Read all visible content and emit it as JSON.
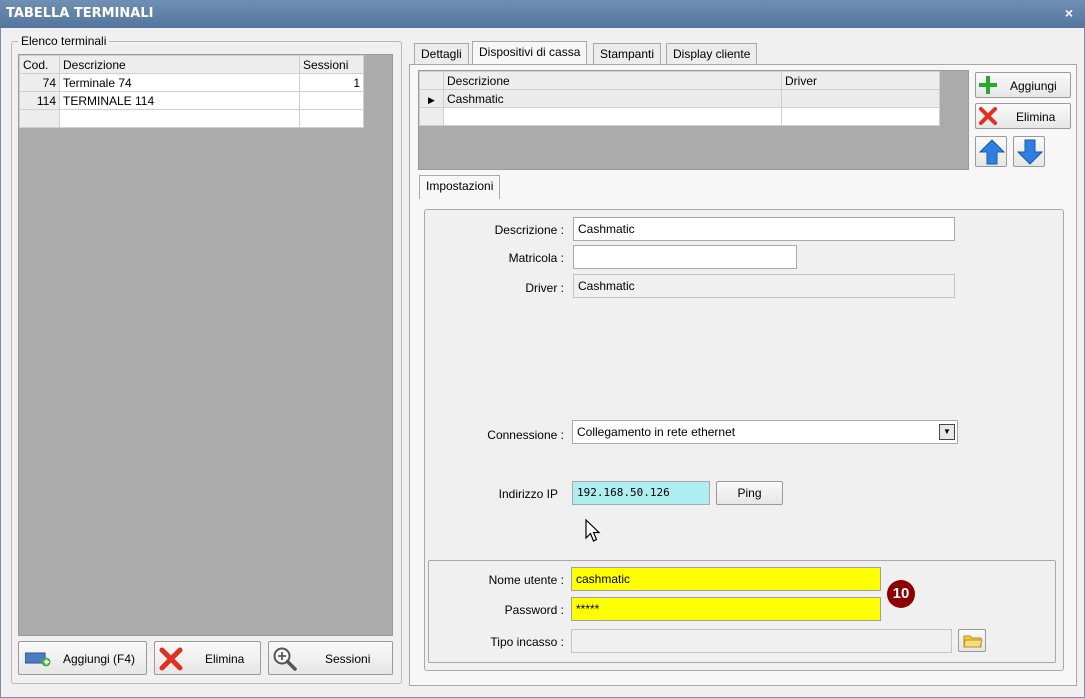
{
  "window": {
    "title": "TABELLA TERMINALI",
    "close": "×"
  },
  "left": {
    "group": "Elenco terminali",
    "columns": [
      "Cod.",
      "Descrizione",
      "Sessioni"
    ],
    "rows": [
      {
        "cod": "74",
        "descr": "Terminale 74",
        "sess": "1"
      },
      {
        "cod": "114",
        "descr": "TERMINALE 114",
        "sess": ""
      }
    ],
    "buttons": {
      "add": "Aggiungi (F4)",
      "delete": "Elimina",
      "sessions": "Sessioni"
    }
  },
  "tabs": [
    "Dettagli",
    "Dispositivi di cassa",
    "Stampanti",
    "Display cliente"
  ],
  "devices": {
    "columns": [
      "Descrizione",
      "Driver"
    ],
    "rows": [
      {
        "descr": "Cashmatic",
        "driver": ""
      }
    ],
    "add": "Aggiungi",
    "delete": "Elimina"
  },
  "subtab": "Impostazioni",
  "form": {
    "descrizione_label": "Descrizione :",
    "descrizione": "Cashmatic",
    "matricola_label": "Matricola :",
    "matricola": "",
    "driver_label": "Driver :",
    "driver": "Cashmatic",
    "connessione_label": "Connessione :",
    "connessione": "Collegamento in rete ethernet",
    "ip_label": "Indirizzo IP",
    "ip": "192.168.50.126",
    "ping": "Ping",
    "user_label": "Nome utente :",
    "user": "cashmatic",
    "password_label": "Password :",
    "password": "*****",
    "tipo_label": "Tipo incasso :",
    "tipo": ""
  },
  "badge": "10",
  "colors": {
    "title": "#54769e",
    "highlight": "#ffff00",
    "ip_bg": "#aeeef0",
    "badge": "#8b0000"
  }
}
